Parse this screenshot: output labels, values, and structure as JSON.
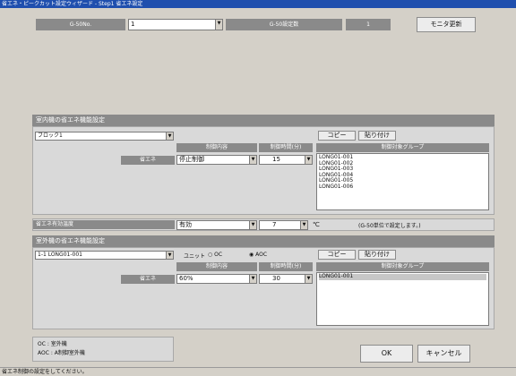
{
  "window": {
    "title": "省エネ・ピークカット設定ウィザード - Step1 省エネ設定"
  },
  "top": {
    "q50_label": "G-50No.",
    "q50_value": "1",
    "config_label": "G-50設定数",
    "config_value": "1",
    "monitor_button": "モニタ更新"
  },
  "indoor": {
    "header": "室内機の省エネ機能設定",
    "block_select": "ブロック1",
    "copy_button": "コピー",
    "paste_button": "貼り付け",
    "col_control": "制御内容",
    "col_time": "制御時間(分)",
    "col_group": "制御対象グループ",
    "row_label": "省エネ",
    "control_value": "停止制御",
    "time_value": "15",
    "groups": [
      "LONG01-001",
      "LONG01-002",
      "LONG01-003",
      "LONG01-004",
      "LONG01-005",
      "LONG01-006"
    ]
  },
  "energy": {
    "label": "省エネ有効温度",
    "value": "有効",
    "temp": "7",
    "unit": "℃",
    "note": "(G-50単位で設定します。)"
  },
  "outdoor": {
    "header": "室外機の省エネ機能設定",
    "unit_select": "1-1 LONG01-001",
    "unit_label": "ユニット",
    "radio_oc_label": "OC",
    "radio_aoc_label": "AOC",
    "copy_button": "コピー",
    "paste_button": "貼り付け",
    "col_control": "制御内容",
    "col_time": "制御時間(分)",
    "col_group": "制御対象グループ",
    "row_label": "省エネ",
    "control_value": "60%",
    "time_value": "30",
    "groups": [
      "LONG01-001"
    ]
  },
  "legend": {
    "line1": "OC : 室外機",
    "line2": "AOC : A制御室外機"
  },
  "buttons": {
    "ok": "OK",
    "cancel": "キャンセル"
  },
  "status": {
    "text": "省エネ制御の設定をしてください。"
  }
}
